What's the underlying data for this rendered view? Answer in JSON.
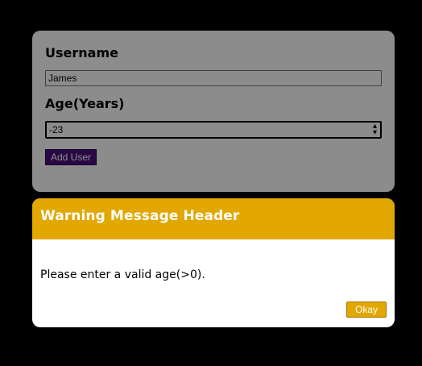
{
  "form": {
    "username_label": "Username",
    "username_value": "James",
    "age_label": "Age(Years)",
    "age_value": "-23",
    "submit_label": "Add User"
  },
  "modal": {
    "title": "Warning Message Header",
    "message": "Please enter a valid age(>0).",
    "button_label": "Okay"
  },
  "colors": {
    "page_background": "#000000",
    "modal_header": "#e2a700",
    "submit_button": "#4b0f7e"
  },
  "icons": {
    "stepper": "up-down-arrows-icon"
  }
}
